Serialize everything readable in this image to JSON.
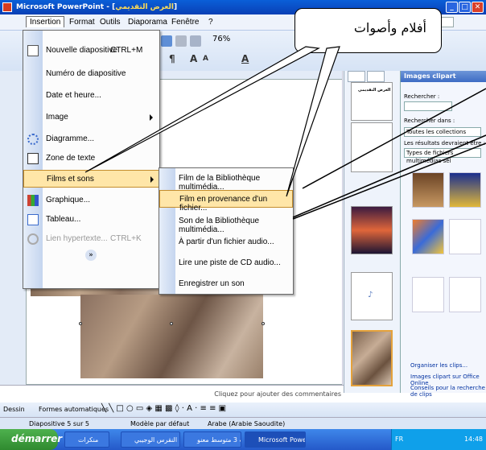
{
  "window": {
    "title_prefix": "Microsoft PowerPoint - [",
    "title_doc": "العرض التقديمي",
    "title_suffix": "]",
    "minimize": "_",
    "maximize": "□",
    "close": "✕"
  },
  "menubar": {
    "items": [
      "Insertion",
      "Format",
      "Outils",
      "Diaporama",
      "Fenêtre",
      "?"
    ],
    "question_box": "uestion"
  },
  "toolbar": {
    "zoom": "76%"
  },
  "insert_menu": {
    "items": [
      {
        "label": "Nouvelle diapositive",
        "shortcut": "CTRL+M"
      },
      {
        "label": "Numéro de diapositive",
        "shortcut": ""
      },
      {
        "label": "Date et heure...",
        "shortcut": ""
      },
      {
        "label": "Image",
        "shortcut": ""
      },
      {
        "label": "Diagramme...",
        "shortcut": ""
      },
      {
        "label": "Zone de texte",
        "shortcut": ""
      },
      {
        "label": "Films et sons",
        "shortcut": ""
      },
      {
        "label": "Graphique...",
        "shortcut": ""
      },
      {
        "label": "Tableau...",
        "shortcut": ""
      },
      {
        "label": "Lien hypertexte...",
        "shortcut": "CTRL+K"
      }
    ],
    "expand": "»"
  },
  "films_submenu": {
    "items": [
      "Film de la Bibliothèque multimédia...",
      "Film en provenance d'un fichier...",
      "Son de la Bibliothèque multimédia...",
      "À partir d'un fichier audio...",
      "Lire une piste de CD audio...",
      "Enregistrer un son"
    ]
  },
  "callout": {
    "text": "أفلام وأصوات"
  },
  "slides_pane": {
    "numbers": [
      "1",
      "2",
      "3",
      "4",
      "5"
    ],
    "thumb1_title": "العرض التقديمي"
  },
  "taskpane": {
    "title": "Images clipart",
    "search_label": "Rechercher :",
    "search_in_label": "Rechercher dans :",
    "collections": "Toutes les collections",
    "results_label": "Les résultats devraient être :",
    "results_value": "Types de fichiers multimédias sél",
    "links": [
      "Organiser les clips...",
      "Images clipart sur Office Online",
      "Conseils pour la recherche de clips"
    ]
  },
  "notes": {
    "text": "Cliquez pour ajouter des commentaires"
  },
  "drawbar": {
    "label": "Dessin",
    "autoshapes": "Formes automatiques"
  },
  "status": {
    "slide": "Diapositive 5 sur 5",
    "design": "Modèle par défaut",
    "language": "Arabe (Arabie Saoudite)"
  },
  "taskbar": {
    "start": "démarrer",
    "tasks": [
      "منكرات",
      "النقرس الوجيبي - Micro...",
      "منكرات 3 متوسط معنو...",
      "Microsoft PowerPoint ..."
    ],
    "lang": "FR",
    "clock": "14:48"
  },
  "colors": {
    "title_bar": "#0a5fd8",
    "menu_hover": "#ffe6a8",
    "taskbar": "#2559c9",
    "start": "#2f8a2f"
  }
}
